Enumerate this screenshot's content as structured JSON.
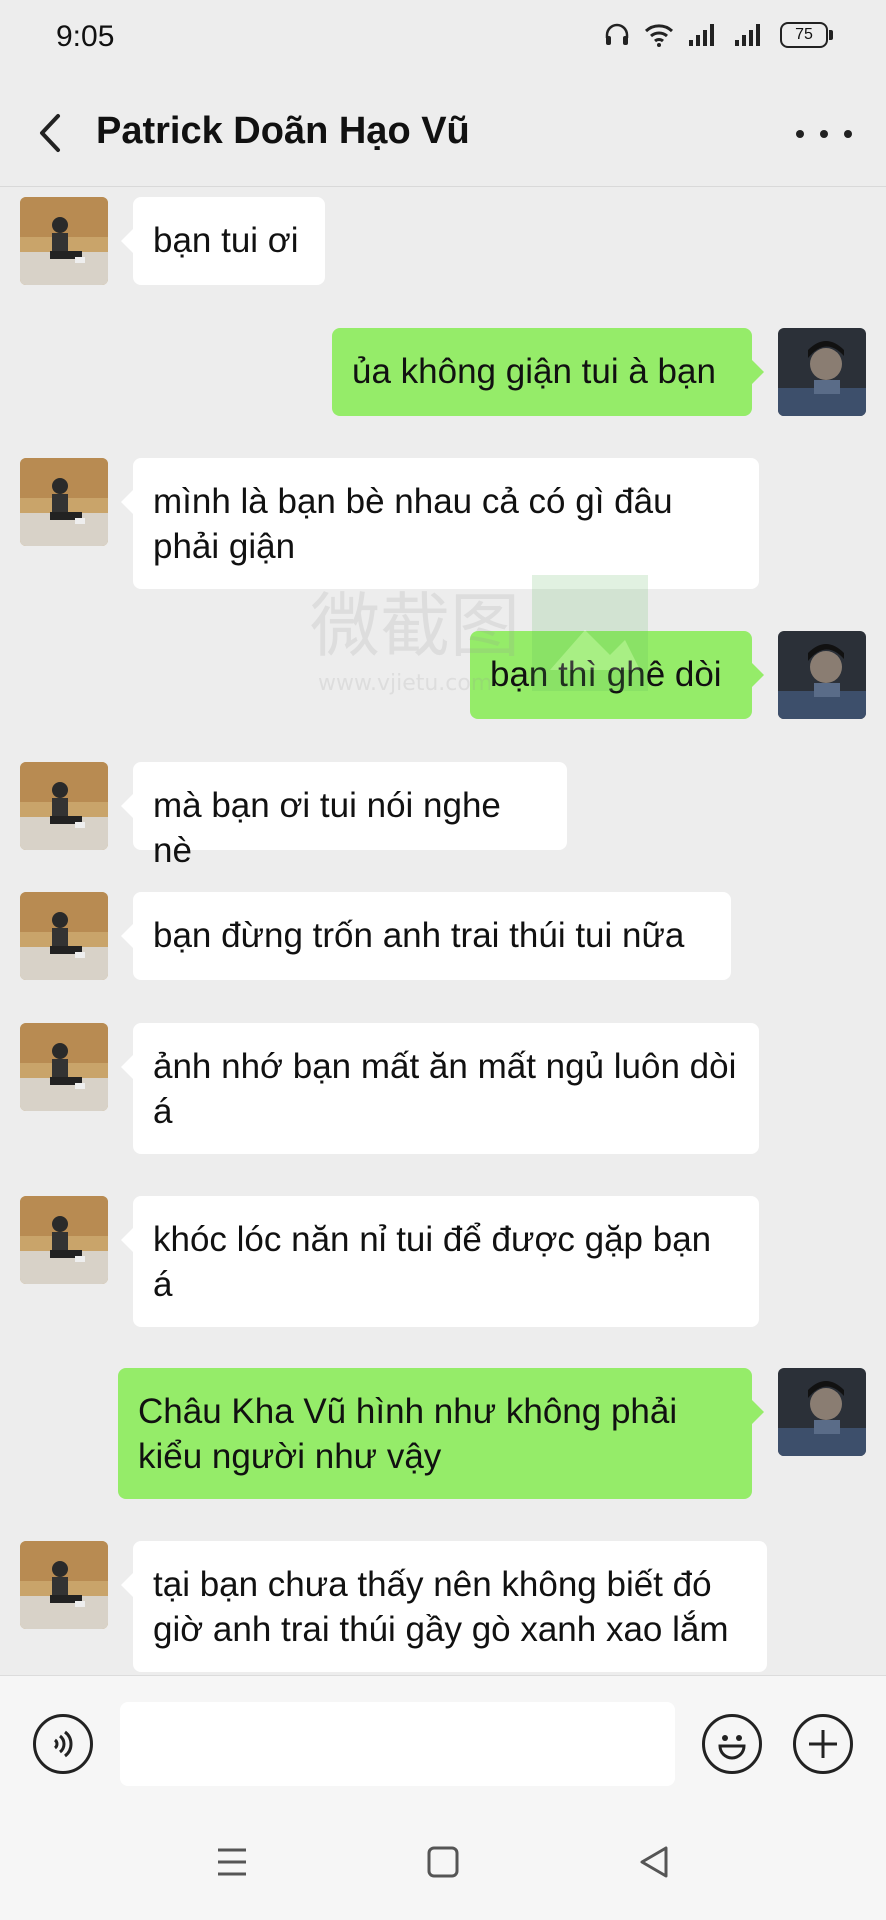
{
  "status": {
    "time": "9:05",
    "battery": "75"
  },
  "header": {
    "title": "Patrick Doãn Hạo Vũ"
  },
  "messages": [
    {
      "side": "in",
      "text": "bạn tui ơi"
    },
    {
      "side": "out",
      "text": "ủa không giận tui à bạn"
    },
    {
      "side": "in",
      "text": "mình là bạn bè nhau cả có gì đâu phải giận"
    },
    {
      "side": "out",
      "text": "bạn thì ghê dòi"
    },
    {
      "side": "in",
      "text": "mà bạn ơi tui nói nghe nè"
    },
    {
      "side": "in",
      "text": "bạn đừng trốn anh trai thúi tui nữa"
    },
    {
      "side": "in",
      "text": "ảnh nhớ bạn mất ăn mất ngủ luôn dòi á"
    },
    {
      "side": "in",
      "text": "khóc lóc năn nỉ tui để được gặp bạn á"
    },
    {
      "side": "out",
      "text": "Châu Kha Vũ hình như không phải kiểu người như vậy"
    },
    {
      "side": "in",
      "text": "tại bạn chưa thấy nên không biết đó giờ anh trai thúi gầy gò xanh xao lắm"
    }
  ],
  "watermark": {
    "cn": "微截图",
    "url": "www.vjietu.com"
  },
  "colors": {
    "outgoing": "#95ec69",
    "incoming": "#ffffff",
    "background": "#ededed"
  },
  "icons": [
    "back-arrow-icon",
    "more-dots-icon",
    "voice-icon",
    "emoji-icon",
    "plus-icon",
    "menu-icon",
    "home-icon",
    "back-triangle-icon"
  ]
}
